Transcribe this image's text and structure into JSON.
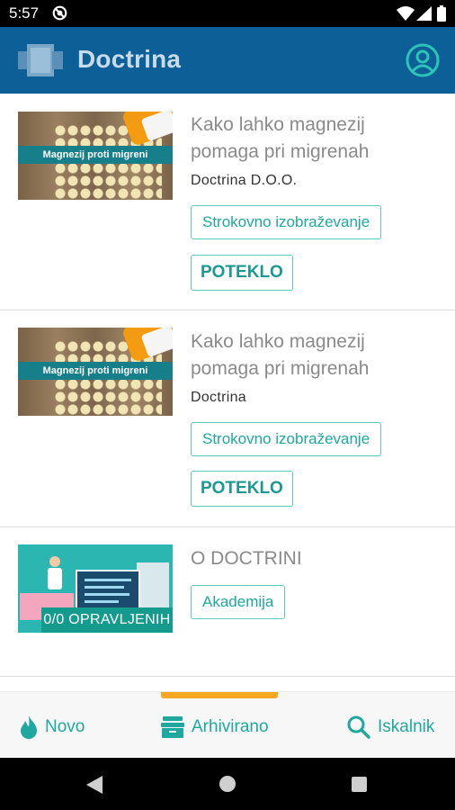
{
  "status_bar": {
    "time": "5:57"
  },
  "app_bar": {
    "title": "Doctrina"
  },
  "cards": [
    {
      "thumb_text": "Magnezij proti migreni",
      "title": "Kako lahko magnezij pomaga pri migrenah",
      "author": "Doctrina D.O.O.",
      "tag": "Strokovno izobraževanje",
      "status": "POTEKLO"
    },
    {
      "thumb_text": "Magnezij proti migreni",
      "title": "Kako lahko magnezij pomaga pri migrenah",
      "author": "Doctrina",
      "tag": "Strokovno izobraževanje",
      "status": "POTEKLO"
    },
    {
      "thumb_text": "0/0 OPRAVLJENIH",
      "title": "O DOCTRINI",
      "tag": "Akademija"
    }
  ],
  "bottom_nav": {
    "items": [
      {
        "label": "Novo",
        "icon": "flame-icon"
      },
      {
        "label": "Arhivirano",
        "icon": "archive-icon"
      },
      {
        "label": "Iskalnik",
        "icon": "search-icon"
      }
    ],
    "active_index": 1
  },
  "colors": {
    "app_bar": "#0d5f98",
    "accent": "#1fa89d",
    "indicator": "#f5a623"
  }
}
